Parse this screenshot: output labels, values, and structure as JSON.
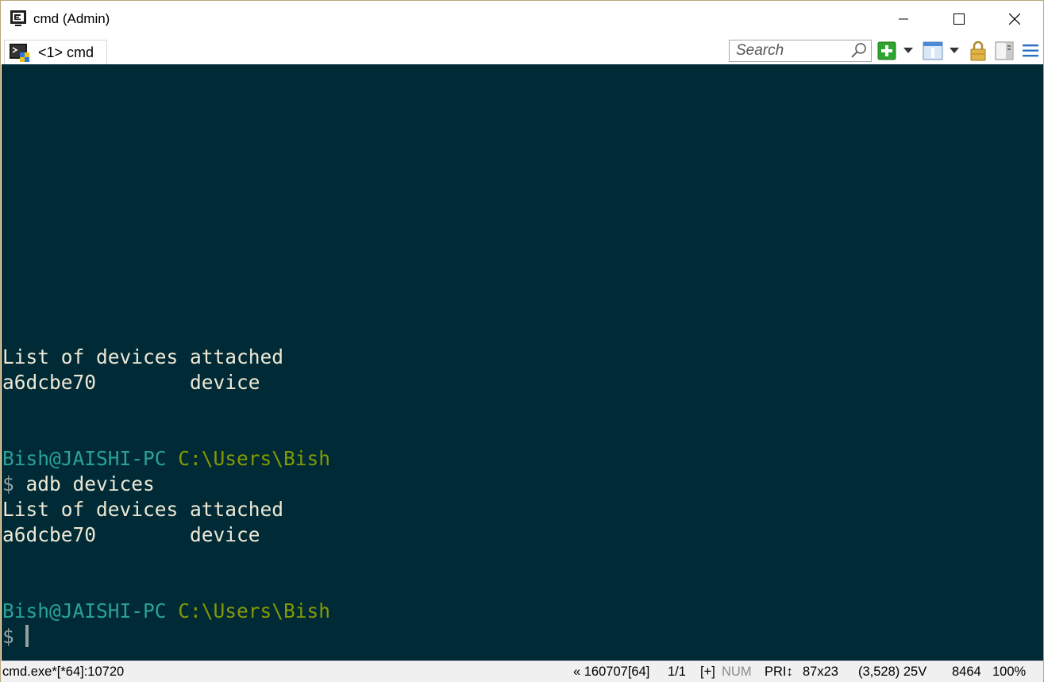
{
  "window": {
    "title": "cmd (Admin)",
    "min_glyph": "─",
    "max_glyph": "☐",
    "close_glyph": "✕"
  },
  "tabbar": {
    "tab_label": "<1> cmd",
    "search_placeholder": "Search",
    "dropdown_glyph": "▼"
  },
  "console": {
    "lines": [
      {
        "text": "List of devices attached"
      },
      {
        "text": "a6dcbe70        device"
      },
      {
        "user": "Bish@JAISHI-PC",
        "path": " C:\\Users\\Bish"
      },
      {
        "dollar": "$",
        "cmd": " adb devices"
      },
      {
        "text": "List of devices attached"
      },
      {
        "text": "a6dcbe70        device"
      },
      {
        "user": "Bish@JAISHI-PC",
        "path": " C:\\Users\\Bish"
      },
      {
        "dollar": "$"
      }
    ]
  },
  "statusbar": {
    "process": "cmd.exe*[*64]:10720",
    "build": "« 160707[64]",
    "pages": "1/1",
    "plus": "[+]",
    "num": "NUM",
    "pri": "PRI↕",
    "size": "87x23",
    "cursor": "(3,528) 25V",
    "pid": "8464",
    "zoom": "100%"
  },
  "colors": {
    "console_bg": "#002b36",
    "prompt_user": "#2aa198",
    "prompt_path": "#859900",
    "text": "#eee8d5"
  },
  "icons": [
    "console-app-icon",
    "tab-console-icon",
    "search-icon",
    "new-console-icon",
    "split-icon",
    "lock-icon",
    "panel-icon",
    "hamburger-menu-icon"
  ]
}
